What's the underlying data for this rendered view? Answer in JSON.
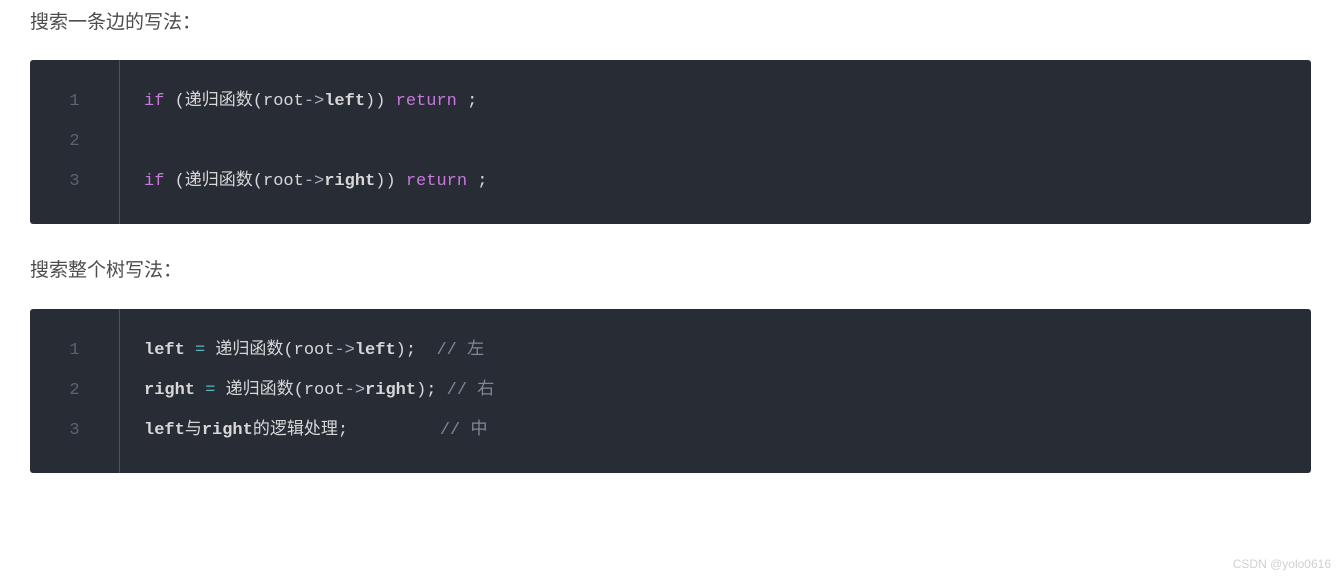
{
  "sections": [
    {
      "heading": "搜索一条边的写法：",
      "code": {
        "line_numbers": [
          "1",
          "2",
          "3"
        ],
        "lines": [
          {
            "tokens": [
              {
                "cls": "kw",
                "text": "if"
              },
              {
                "cls": "plain",
                "text": " (递归函数(root"
              },
              {
                "cls": "arrow",
                "text": "->"
              },
              {
                "cls": "plain bold",
                "text": "left"
              },
              {
                "cls": "plain",
                "text": ")) "
              },
              {
                "cls": "kw",
                "text": "return"
              },
              {
                "cls": "plain",
                "text": " ;"
              }
            ]
          },
          {
            "tokens": []
          },
          {
            "tokens": [
              {
                "cls": "kw",
                "text": "if"
              },
              {
                "cls": "plain",
                "text": " (递归函数(root"
              },
              {
                "cls": "arrow",
                "text": "->"
              },
              {
                "cls": "plain bold",
                "text": "right"
              },
              {
                "cls": "plain",
                "text": ")) "
              },
              {
                "cls": "kw",
                "text": "return"
              },
              {
                "cls": "plain",
                "text": " ;"
              }
            ]
          }
        ]
      }
    },
    {
      "heading": "搜索整个树写法：",
      "code": {
        "line_numbers": [
          "1",
          "2",
          "3"
        ],
        "lines": [
          {
            "tokens": [
              {
                "cls": "plain bold",
                "text": "left"
              },
              {
                "cls": "plain",
                "text": " "
              },
              {
                "cls": "op",
                "text": "="
              },
              {
                "cls": "plain",
                "text": " 递归函数(root"
              },
              {
                "cls": "arrow",
                "text": "->"
              },
              {
                "cls": "plain bold",
                "text": "left"
              },
              {
                "cls": "plain",
                "text": ");  "
              },
              {
                "cls": "cmt",
                "text": "// 左"
              }
            ]
          },
          {
            "tokens": [
              {
                "cls": "plain bold",
                "text": "right"
              },
              {
                "cls": "plain",
                "text": " "
              },
              {
                "cls": "op",
                "text": "="
              },
              {
                "cls": "plain",
                "text": " 递归函数(root"
              },
              {
                "cls": "arrow",
                "text": "->"
              },
              {
                "cls": "plain bold",
                "text": "right"
              },
              {
                "cls": "plain",
                "text": "); "
              },
              {
                "cls": "cmt",
                "text": "// 右"
              }
            ]
          },
          {
            "tokens": [
              {
                "cls": "plain bold",
                "text": "left"
              },
              {
                "cls": "plain",
                "text": "与"
              },
              {
                "cls": "plain bold",
                "text": "right"
              },
              {
                "cls": "plain",
                "text": "的逻辑处理;         "
              },
              {
                "cls": "cmt",
                "text": "// 中"
              }
            ]
          }
        ]
      }
    }
  ],
  "watermark": "CSDN @yolo0616"
}
